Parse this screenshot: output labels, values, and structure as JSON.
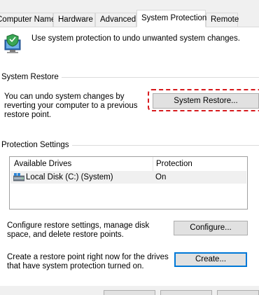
{
  "tabs": [
    {
      "label": "Computer Name"
    },
    {
      "label": "Hardware"
    },
    {
      "label": "Advanced"
    },
    {
      "label": "System Protection"
    },
    {
      "label": "Remote"
    }
  ],
  "intro_text": "Use system protection to undo unwanted system changes.",
  "system_restore": {
    "title": "System Restore",
    "description": "You can undo system changes by reverting your computer to a previous restore point.",
    "button_label": "System Restore..."
  },
  "protection_settings": {
    "title": "Protection Settings",
    "columns": [
      "Available Drives",
      "Protection"
    ],
    "drives": [
      {
        "name": "Local Disk (C:) (System)",
        "protection": "On"
      }
    ],
    "configure_text": "Configure restore settings, manage disk space, and delete restore points.",
    "configure_label": "Configure...",
    "create_text": "Create a restore point right now for the drives that have system protection turned on.",
    "create_label": "Create..."
  },
  "colors": {
    "highlight": "#d7191c",
    "focus": "#0078d7"
  }
}
